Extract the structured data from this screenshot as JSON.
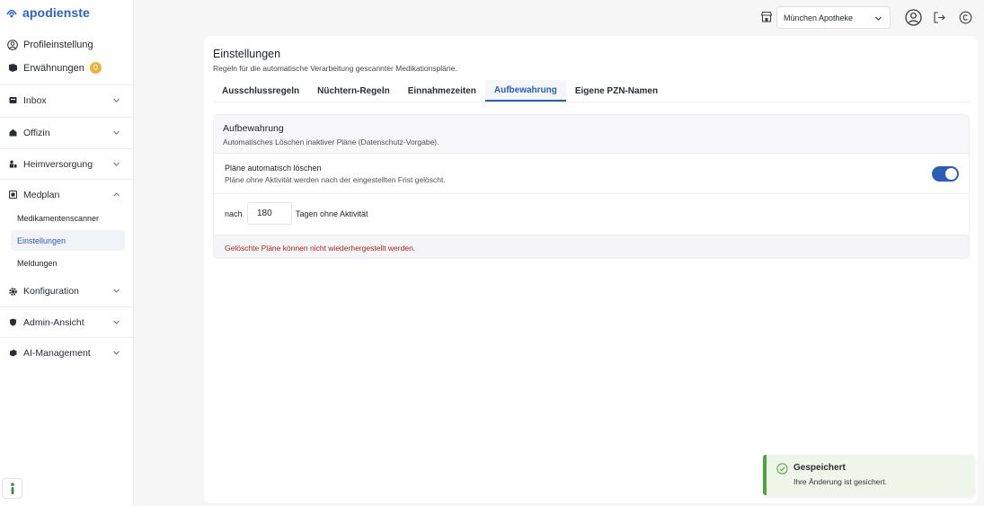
{
  "brand": {
    "name": "apodienste",
    "color": "#2f63c9"
  },
  "sidebar": {
    "profile_label": "Profileinstellung",
    "awards_label": "Erwähnungen",
    "awards_count": "0",
    "items": [
      {
        "label": "Inbox",
        "icon": "inbox-icon"
      },
      {
        "label": "Offizin",
        "icon": "pharmacy-icon"
      },
      {
        "label": "Heimversorgung",
        "icon": "care-home-icon"
      },
      {
        "label": "Medplan",
        "icon": "medplan-icon",
        "expanded": true,
        "children": [
          {
            "label": "Medikamentenscanner"
          },
          {
            "label": "Einstellungen",
            "active": true
          },
          {
            "label": "Meldungen"
          }
        ]
      },
      {
        "label": "Konfiguration",
        "icon": "gear-icon"
      },
      {
        "label": "Admin-Ansicht",
        "icon": "shield-icon"
      },
      {
        "label": "AI-Management",
        "icon": "ai-icon"
      }
    ]
  },
  "topbar": {
    "store_select_value": "München Apotheke"
  },
  "page": {
    "title": "Einstellungen",
    "subtitle": "Regeln für die automatische Verarbeitung gescannter Medikationspläne.",
    "tabs": [
      {
        "label": "Ausschlussregeln"
      },
      {
        "label": "Nüchtern-Regeln"
      },
      {
        "label": "Einnahmezeiten"
      },
      {
        "label": "Aufbewahrung",
        "active": true
      },
      {
        "label": "Eigene PZN-Namen"
      }
    ]
  },
  "retention": {
    "title": "Aufbewahrung",
    "subtitle": "Automatisches Löschen inaktiver Pläne (Datenschutz-Vorgabe).",
    "auto_delete_label": "Pläne automatisch löschen",
    "auto_delete_hint": "Pläne ohne Aktivität werden nach der eingestellten Frist gelöscht.",
    "auto_delete_enabled": true,
    "nach_label": "nach",
    "days_value": "180",
    "days_suffix": "Tagen ohne Aktivität",
    "warning": "Gelöschte Pläne können nicht wiederhergestellt werden."
  },
  "toast": {
    "title": "Gespeichert",
    "message": "Ihre Änderung ist gesichert."
  },
  "colors": {
    "accent": "#2b5db7",
    "warning_text": "#a1291f",
    "success": "#52a146",
    "badge": "#e9b23d"
  }
}
